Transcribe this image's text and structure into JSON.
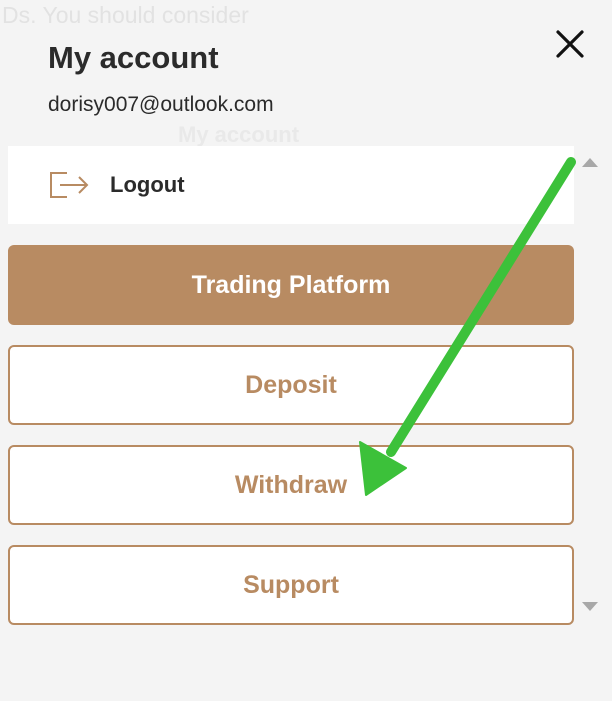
{
  "background": {
    "notice_text": "Ds. You should consider",
    "ghost_title": "My account"
  },
  "header": {
    "title": "My account",
    "email": "dorisy007@outlook.com",
    "close_icon": "close-icon"
  },
  "menu": {
    "logout_label": "Logout",
    "logout_icon": "logout-icon"
  },
  "buttons": {
    "trading_platform": "Trading Platform",
    "deposit": "Deposit",
    "withdraw": "Withdraw",
    "support": "Support"
  },
  "colors": {
    "accent": "#b88b62",
    "text": "#2b2b2b",
    "annotation_arrow": "#3cc13a"
  }
}
